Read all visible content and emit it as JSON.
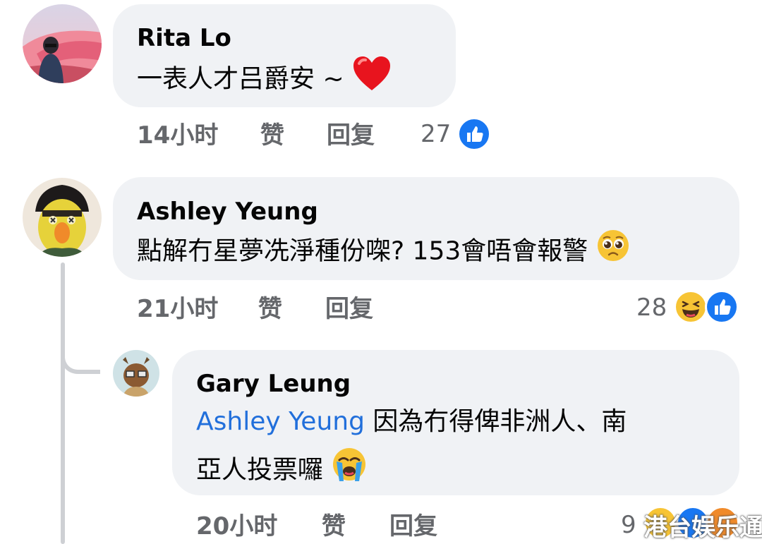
{
  "comments": [
    {
      "author": "Rita Lo",
      "text": "一表人才吕爵安 ~",
      "time": "14小时",
      "like_label": "赞",
      "reply_label": "回复",
      "reaction_count": "27"
    },
    {
      "author": "Ashley Yeung",
      "text": "點解冇星夢冼淨種份㗎? 153會唔會報警",
      "time": "21小时",
      "like_label": "赞",
      "reply_label": "回复",
      "reaction_count": "28"
    },
    {
      "author": "Gary Leung",
      "mention": "Ashley Yeung",
      "text_line1": "因為冇得俾非洲人、南",
      "text_line2": "亞人投票囉",
      "time": "20小时",
      "like_label": "赞",
      "reply_label": "回复",
      "reaction_count": "9"
    }
  ],
  "watermark": "港台娱乐通",
  "colors": {
    "bubble": "#f0f2f5",
    "meta": "#65676b",
    "mention": "#216fdb",
    "like_blue": "#1877f2",
    "haha_yellow": "#f7c435"
  }
}
